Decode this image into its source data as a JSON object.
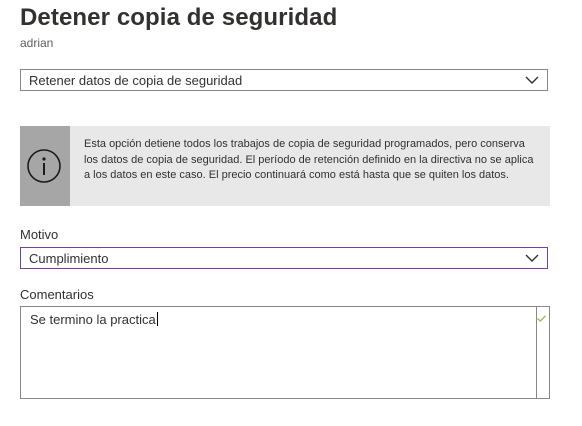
{
  "header": {
    "title": "Detener copia de seguridad",
    "subtitle": "adrian"
  },
  "action_dropdown": {
    "selected": "Retener datos de copia de seguridad",
    "icon": "chevron-down-icon"
  },
  "info": {
    "icon": "info-icon",
    "text": "Esta opción detiene todos los trabajos de copia de seguridad programados, pero conserva los datos de copia de seguridad. El período de retención definido en la directiva no se aplica a los datos en este caso. El precio continuará como está hasta que se quiten los datos."
  },
  "reason": {
    "label": "Motivo",
    "selected": "Cumplimiento",
    "icon": "chevron-down-icon"
  },
  "comments": {
    "label": "Comentarios",
    "value": "Se termino la practica",
    "valid_icon": "checkmark-icon"
  },
  "colors": {
    "focus_border": "#7a3e9d",
    "info_strip": "#a6a6a6",
    "info_background": "#e8e8e8",
    "valid_check": "#8cbd4a"
  }
}
